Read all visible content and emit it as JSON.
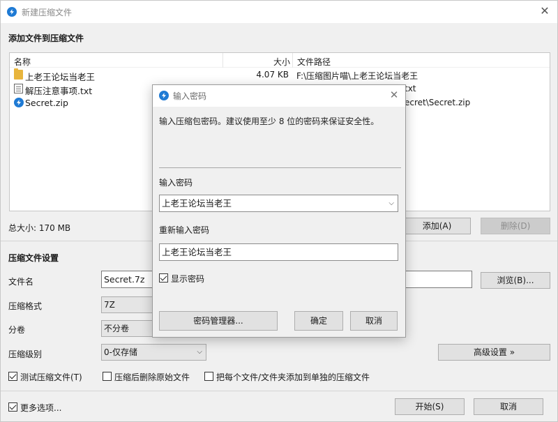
{
  "window": {
    "title": "新建压缩文件"
  },
  "add_section": {
    "title": "添加文件到压缩文件",
    "columns": {
      "name": "名称",
      "size": "大小",
      "path": "文件路径"
    },
    "files": [
      {
        "name": "上老王论坛当老王",
        "size": "4.07 KB",
        "path": "F:\\压缩图片喵\\上老王论坛当老王",
        "icon": "folder-icon"
      },
      {
        "name": "解压注意事项.txt",
        "size": "",
        "path": "txt",
        "icon": "text-file-icon"
      },
      {
        "name": "Secret.zip",
        "size": "",
        "path": "ecret\\Secret.zip",
        "icon": "zip-file-icon"
      }
    ],
    "total_size": "总大小: 170 MB",
    "add_button": "添加(A)",
    "remove_button": "删除(D)"
  },
  "settings": {
    "title": "压缩文件设置",
    "filename_label": "文件名",
    "filename_value": "Secret.7z",
    "browse_button": "浏览(B)...",
    "format_label": "压缩格式",
    "format_value": "7Z",
    "volume_label": "分卷",
    "volume_value": "不分卷",
    "level_label": "压缩级别",
    "level_value": "0-仅存储",
    "advanced_button": "高级设置 »",
    "test_archive": {
      "label": "测试压缩文件(T)",
      "checked": true
    },
    "delete_original": {
      "label": "压缩后删除原始文件",
      "checked": false
    },
    "separate_archives": {
      "label": "把每个文件/文件夹添加到单独的压缩文件",
      "checked": false
    }
  },
  "footer": {
    "more_options": {
      "label": "更多选项...",
      "checked": true
    },
    "start_button": "开始(S)",
    "cancel_button": "取消"
  },
  "password_dialog": {
    "title": "输入密码",
    "message": "输入压缩包密码。建议使用至少 8 位的密码来保证安全性。",
    "password_label": "输入密码",
    "password_value": "上老王论坛当老王",
    "confirm_label": "重新输入密码",
    "confirm_value": "上老王论坛当老王",
    "show_password": {
      "label": "显示密码",
      "checked": true
    },
    "manager_button": "密码管理器...",
    "ok_button": "确定",
    "cancel_button": "取消"
  },
  "colors": {
    "accent": "#1e7ad4",
    "window_bg": "#f0f0f0",
    "folder": "#e8b53d"
  }
}
